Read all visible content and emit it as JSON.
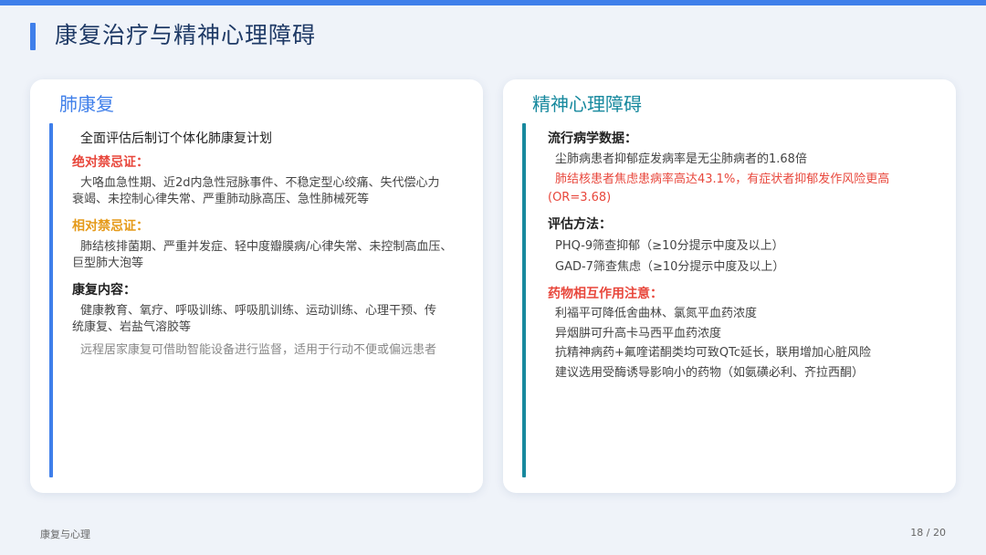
{
  "header": {
    "title": "康复治疗与精神心理障碍"
  },
  "left": {
    "title": "肺康复",
    "intro": "全面评估后制订个体化肺康复计划",
    "absolute_heading": "绝对禁忌证：",
    "absolute_lines": [
      "大咯血急性期、近2d内急性冠脉事件、不稳定型心绞痛、失代偿心力",
      "衰竭、未控制心律失常、严重肺动脉高压、急性肺械死等"
    ],
    "relative_heading": "相对禁忌证：",
    "relative_lines": [
      "肺结核排菌期、严重并发症、轻中度瓣膜病/心律失常、未控制高血压、",
      "巨型肺大泡等"
    ],
    "content_heading": "康复内容：",
    "content_lines": [
      "健康教育、氧疗、呼吸训练、呼吸肌训练、运动训练、心理干预、传",
      "统康复、岩盐气溶胶等"
    ],
    "note": "远程居家康复可借助智能设备进行监督，适用于行动不便或偏远患者"
  },
  "right": {
    "title": "精神心理障碍",
    "epi_heading": "流行病学数据：",
    "epi_line1": "尘肺病患者抑郁症发病率是无尘肺病者的1.68倍",
    "epi_red_lines": [
      "肺结核患者焦虑患病率高达43.1%，有症状者抑郁发作风险更高",
      "(OR=3.68)"
    ],
    "assess_heading": "评估方法：",
    "assess_lines": [
      "PHQ-9筛查抑郁（≥10分提示中度及以上）",
      "GAD-7筛查焦虑（≥10分提示中度及以上）"
    ],
    "drug_heading": "药物相互作用注意：",
    "drug_lines": [
      "利福平可降低舍曲林、氯氮平血药浓度",
      "异烟肼可升高卡马西平血药浓度",
      "抗精神病药+氟喹诺酮类均可致QTc延长，联用增加心脏风险",
      "建议选用受酶诱导影响小的药物（如氨磺必利、齐拉西酮）"
    ]
  },
  "footer": {
    "section": "康复与心理",
    "page": "18 / 20"
  },
  "colors": {
    "accent_blue": "#3f7fea",
    "accent_teal": "#17899e",
    "warning_red": "#e8473c",
    "caution_orange": "#e59a1a"
  }
}
